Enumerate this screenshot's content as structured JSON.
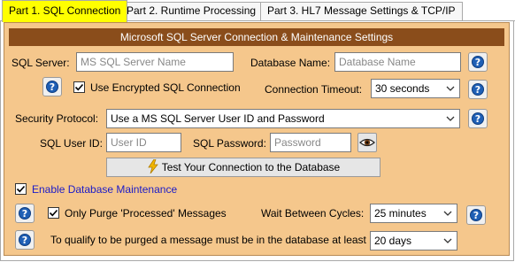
{
  "tabs": [
    {
      "label": "Part 1. SQL Connection",
      "active": true
    },
    {
      "label": "Part 2. Runtime Processing",
      "active": false
    },
    {
      "label": "Part 3. HL7 Message Settings & TCP/IP",
      "active": false
    }
  ],
  "header": {
    "title": "Microsoft SQL Server Connection & Maintenance Settings"
  },
  "connection": {
    "sql_server_label": "SQL Server:",
    "sql_server_placeholder": "MS SQL Server Name",
    "database_name_label": "Database Name:",
    "database_name_placeholder": "Database Name",
    "encrypted_label": "Use Encrypted SQL Connection",
    "encrypted_checked": true,
    "timeout_label": "Connection Timeout:",
    "timeout_value": "30 seconds",
    "security_protocol_label": "Security Protocol:",
    "security_protocol_value": "Use a MS SQL Server User ID and Password",
    "user_id_label": "SQL User ID:",
    "user_id_placeholder": "User ID",
    "password_label": "SQL Password:",
    "password_placeholder": "Password",
    "test_button_label": "Test Your Connection to the Database"
  },
  "maintenance": {
    "enable_label": "Enable Database Maintenance",
    "enable_checked": true,
    "purge_label": "Only Purge 'Processed' Messages",
    "purge_checked": true,
    "wait_label": "Wait Between Cycles:",
    "wait_value": "25 minutes",
    "qualify_label": "To qualify to be purged a message must be in the database at least",
    "qualify_value": "20 days"
  },
  "colors": {
    "active_tab": "#ffff00",
    "panel_bg": "#f5c78c",
    "header_bg": "#8a4d1b",
    "help_icon": "#1f5fb5",
    "link_text": "#1a1ac8"
  },
  "icons": {
    "help": "question-circle-icon",
    "lightning": "lightning-icon",
    "eye": "eye-icon",
    "dropdown": "chevron-down-icon",
    "check": "checkmark-icon"
  }
}
